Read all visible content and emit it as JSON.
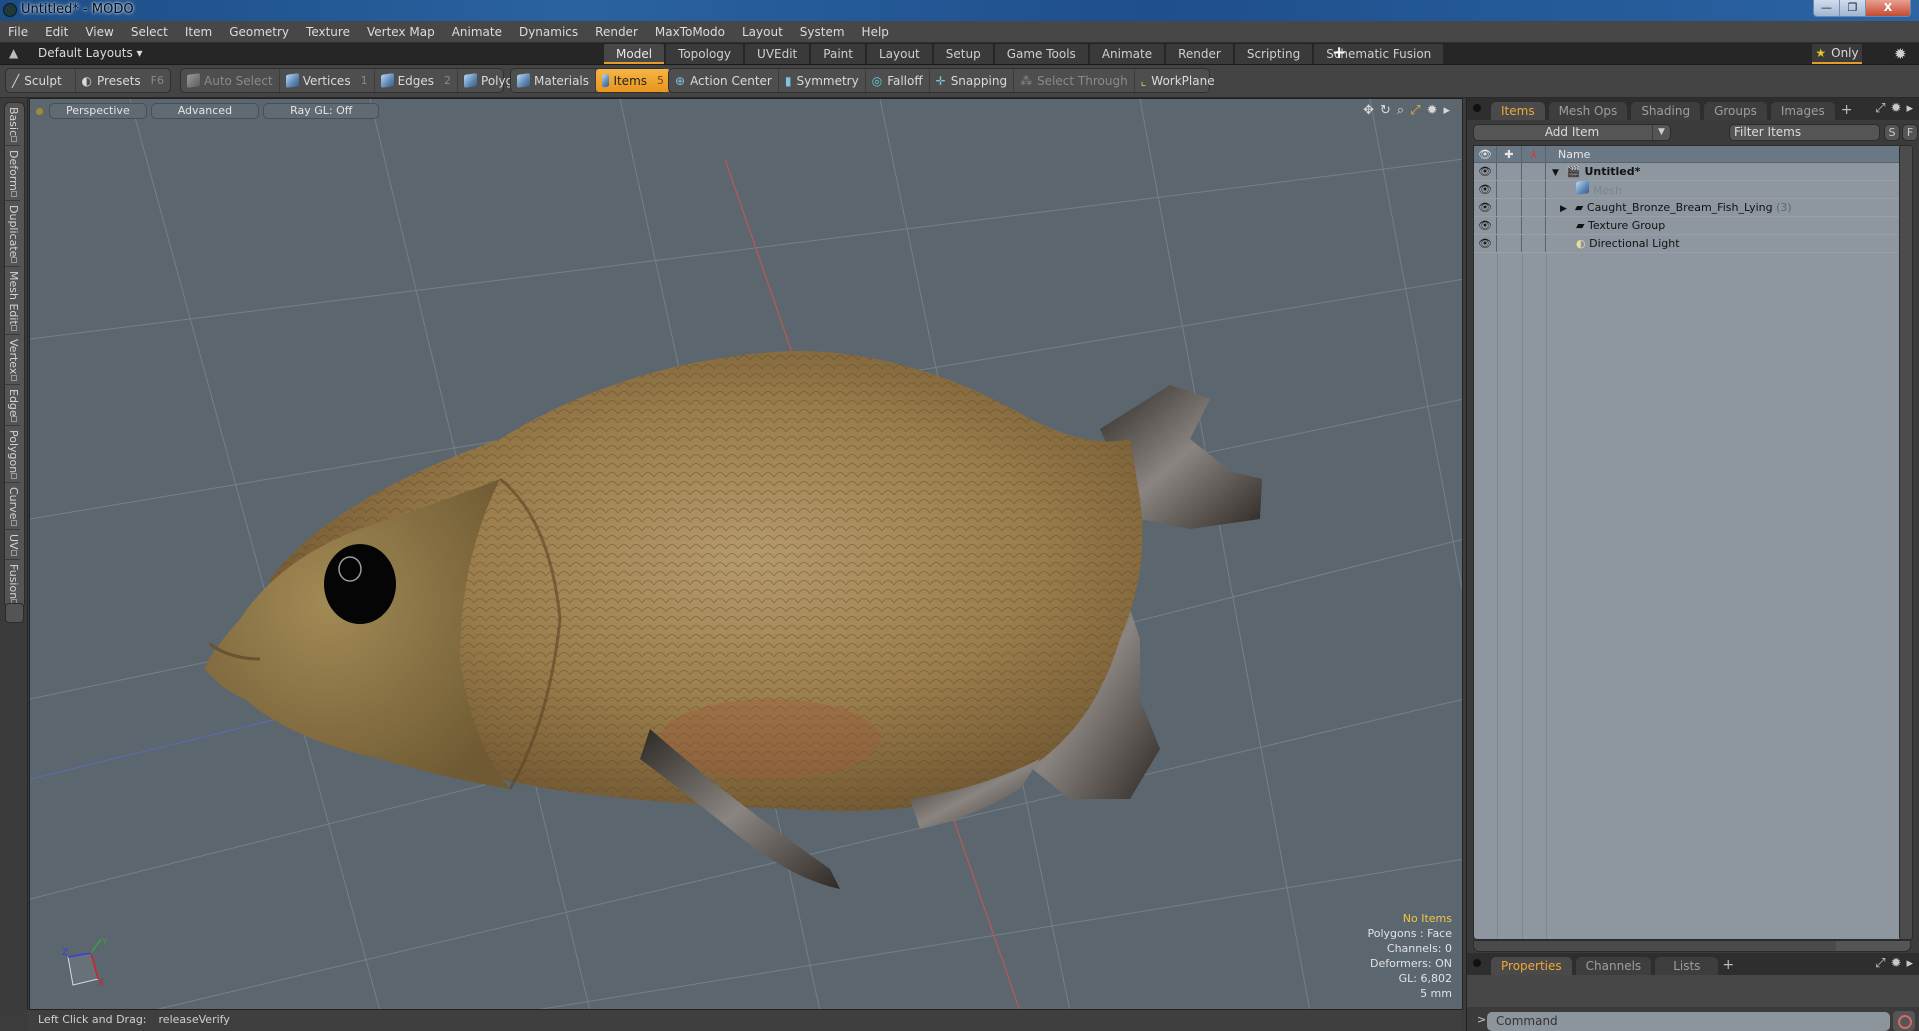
{
  "window": {
    "title": "Untitled* - MODO",
    "buttons": {
      "minimize": "—",
      "restore": "❐",
      "close": "X"
    }
  },
  "menu": [
    "File",
    "Edit",
    "View",
    "Select",
    "Item",
    "Geometry",
    "Texture",
    "Vertex Map",
    "Animate",
    "Dynamics",
    "Render",
    "MaxToModo",
    "Layout",
    "System",
    "Help"
  ],
  "layouts": {
    "default_label": "Default Layouts ▾",
    "tabs": [
      {
        "label": "Model",
        "active": true
      },
      {
        "label": "Topology"
      },
      {
        "label": "UVEdit"
      },
      {
        "label": "Paint"
      },
      {
        "label": "Layout"
      },
      {
        "label": "Setup"
      },
      {
        "label": "Game Tools"
      },
      {
        "label": "Animate"
      },
      {
        "label": "Render"
      },
      {
        "label": "Scripting"
      },
      {
        "label": "Schematic Fusion"
      }
    ],
    "add_tab": "+",
    "only_label": "Only"
  },
  "toolbar": {
    "sculpt": "Sculpt",
    "presets": "Presets",
    "presets_key": "F6",
    "auto_select": "Auto Select",
    "vertices": "Vertices",
    "vertices_key": "1",
    "edges": "Edges",
    "edges_key": "2",
    "polygons": "Polygons",
    "materials": "Materials",
    "items": "Items",
    "items_key": "5",
    "action_center": "Action Center",
    "symmetry": "Symmetry",
    "falloff": "Falloff",
    "snapping": "Snapping",
    "select_through": "Select Through",
    "workplane": "WorkPlane"
  },
  "left_tabs": [
    "Basic",
    "Deform",
    "Duplicate",
    "Mesh Edit",
    "Vertex",
    "Edge",
    "Polygon",
    "Curve",
    "UV",
    "Fusion"
  ],
  "viewport": {
    "view_mode": "Perspective",
    "shading": "Advanced",
    "raygl": "Ray GL: Off",
    "info": {
      "selection": "No Items",
      "polygons": "Polygons : Face",
      "channels": "Channels: 0",
      "deformers": "Deformers: ON",
      "gl": "GL: 6,802",
      "unit": "5 mm"
    },
    "axes": {
      "x": "X",
      "y": "Y",
      "z": "Z"
    }
  },
  "status": {
    "label": "Left Click and Drag:",
    "value": "releaseVerify"
  },
  "items_panel": {
    "tabs": [
      {
        "label": "Items",
        "active": true
      },
      {
        "label": "Mesh Ops"
      },
      {
        "label": "Shading"
      },
      {
        "label": "Groups"
      },
      {
        "label": "Images"
      }
    ],
    "add_tab": "+",
    "add_item": "Add Item",
    "filter_placeholder": "Filter Items",
    "s_btn": "S",
    "f_btn": "F",
    "column_name": "Name",
    "rows": [
      {
        "name": "Untitled*",
        "bold": true,
        "expander": "▼",
        "icon": "scene-icon"
      },
      {
        "name": "Mesh",
        "dim": true,
        "icon": "mesh-icon"
      },
      {
        "name": "Caught_Bronze_Bream_Fish_Lying",
        "count": "(3)",
        "expander": "▶",
        "icon": "group-folder-icon"
      },
      {
        "name": "Texture Group",
        "icon": "group-folder-icon"
      },
      {
        "name": "Directional Light",
        "icon": "light-icon"
      }
    ]
  },
  "properties_panel": {
    "tabs": [
      {
        "label": "Properties",
        "active": true
      },
      {
        "label": "Channels"
      },
      {
        "label": "Lists"
      }
    ],
    "add_tab": "+"
  },
  "command": {
    "prompt": ">",
    "placeholder": "Command"
  },
  "colors": {
    "accent": "#e39c2a",
    "viewport_bg": "#5c666e",
    "tree_bg": "#8e979f",
    "info_highlight": "#efc549"
  }
}
